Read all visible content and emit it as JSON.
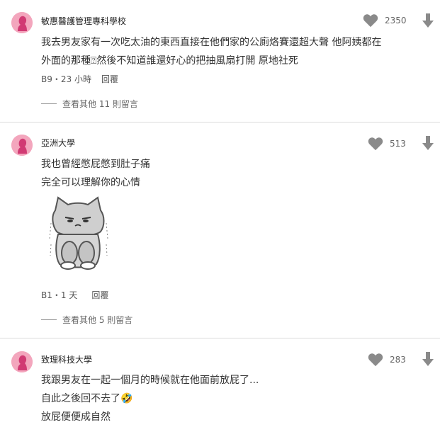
{
  "comments": [
    {
      "school": "敏惠醫護管理專科學校",
      "lines": [
        "我去男友家有一次吃太油的東西直接在他們家的公廁烙賽還超大聲 他阿姨都在",
        "外面的那種⍰然後不知道誰還好心的把抽風扇打開 原地社死"
      ],
      "meta": "B9・23 小時",
      "reply": "回覆",
      "likes": "2350",
      "more": "查看其他 11 則留言"
    },
    {
      "school": "亞洲大學",
      "lines": [
        "我也曾經憋屁憋到肚子痛",
        "完全可以理解你的心情"
      ],
      "meta": "B1・1 天",
      "reply": "回覆",
      "likes": "513",
      "more": "查看其他 5 則留言"
    },
    {
      "school": "致理科技大學",
      "lines": [
        "我跟男友在一起一個月的時候就在他面前放屁了...",
        "自此之後回不去了🤣",
        "放屁便便成自然"
      ],
      "likes": "283"
    }
  ],
  "icons": {
    "like": "heart-icon",
    "dislike": "arrow-down-icon",
    "avatar": "anonymous-female-avatar-icon",
    "sticker": "sad-gray-cat-sticker"
  },
  "colors": {
    "avatar_bg": "#f3a6bd",
    "avatar_fg": "#d13a73",
    "icon_gray": "#8a8a8a"
  }
}
